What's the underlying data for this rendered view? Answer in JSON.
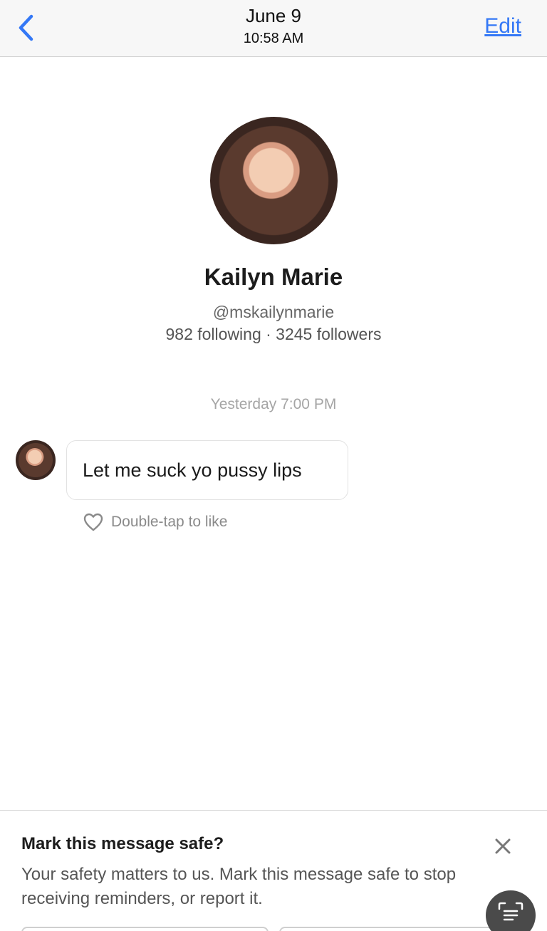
{
  "header": {
    "date": "June 9",
    "time": "10:58 AM",
    "edit_label": "Edit",
    "accent_color": "#3478f6"
  },
  "profile": {
    "name": "Kailyn Marie",
    "handle": "@mskailynmarie",
    "stats": "982 following · 3245 followers"
  },
  "conversation": {
    "timestamp": "Yesterday 7:00 PM",
    "messages": [
      {
        "text": "Let me suck yo pussy lips",
        "like_hint": "Double-tap to like"
      }
    ]
  },
  "safety_sheet": {
    "title": "Mark this message safe?",
    "body": "Your safety matters to us. Mark this message safe to stop receiving reminders, or report it."
  },
  "icons": {
    "back": "chevron-left-icon",
    "like": "heart-icon",
    "close": "close-icon",
    "scan": "text-scan-icon"
  }
}
